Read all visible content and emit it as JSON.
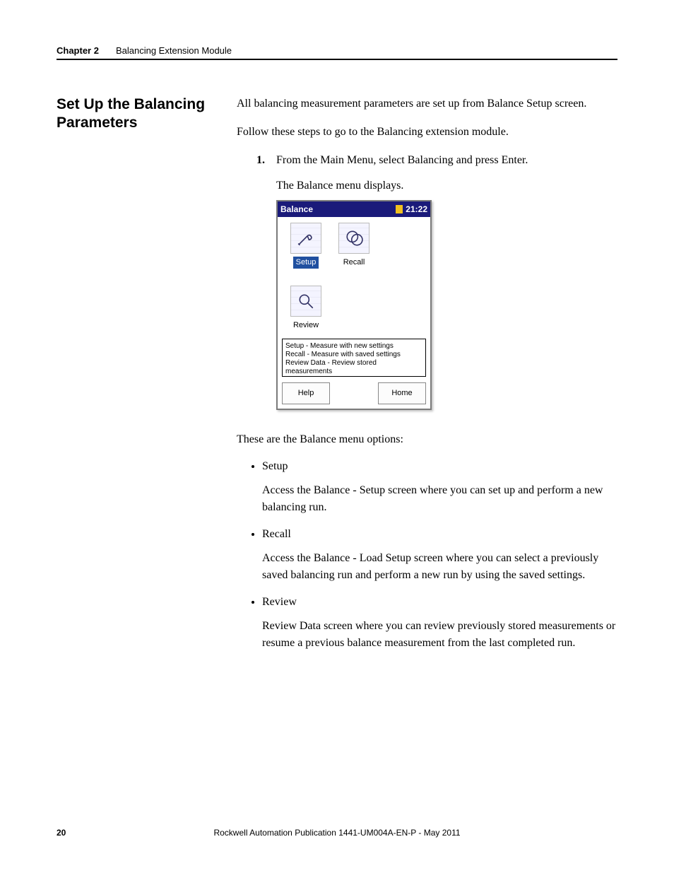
{
  "header": {
    "chapter": "Chapter 2",
    "title": "Balancing Extension Module"
  },
  "section_heading": "Set Up the Balancing Parameters",
  "intro1": "All balancing measurement parameters are set up from Balance Setup screen.",
  "intro2": "Follow these steps to go to the Balancing extension module.",
  "steps": [
    {
      "num": "1.",
      "text": "From the Main Menu, select Balancing and press Enter.",
      "result": "The Balance menu displays."
    }
  ],
  "device": {
    "title": "Balance",
    "time": "21:22",
    "icons": [
      {
        "label": "Setup",
        "selected": true
      },
      {
        "label": "Recall",
        "selected": false
      },
      {
        "label": "Review",
        "selected": false
      }
    ],
    "status_lines": [
      "Setup - Measure with new settings",
      "Recall - Measure with saved settings",
      "Review Data - Review stored measurements"
    ],
    "btn_help": "Help",
    "btn_home": "Home"
  },
  "options_intro": "These are the Balance menu options:",
  "options": [
    {
      "name": "Setup",
      "desc": "Access the Balance - Setup screen where you can set up and perform a new balancing run."
    },
    {
      "name": "Recall",
      "desc": "Access the Balance - Load Setup screen where you can select a previously saved balancing run and perform a new run by using the saved settings."
    },
    {
      "name": "Review",
      "desc": "Review Data screen where you can review previously stored measurements or resume a previous balance measurement from the last completed run."
    }
  ],
  "footer": {
    "page": "20",
    "publication": "Rockwell Automation Publication 1441-UM004A-EN-P - May 2011"
  }
}
